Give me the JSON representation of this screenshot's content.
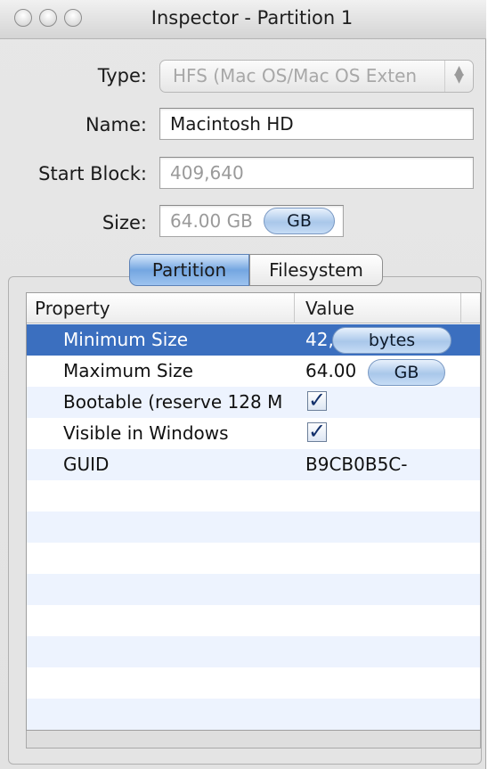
{
  "window": {
    "title": "Inspector - Partition 1"
  },
  "form": {
    "type_label": "Type:",
    "type_value": "HFS (Mac OS/Mac OS Exten",
    "name_label": "Name:",
    "name_value": "Macintosh HD",
    "start_block_label": "Start Block:",
    "start_block_value": "409,640",
    "size_label": "Size:",
    "size_value": "64.00 GB",
    "size_unit": "GB"
  },
  "tabs": {
    "partition": "Partition",
    "filesystem": "Filesystem"
  },
  "table": {
    "columns": [
      "Property",
      "Value"
    ],
    "rows": [
      {
        "property": "Minimum Size",
        "value": "42,72",
        "unit": "bytes",
        "selected": true
      },
      {
        "property": "Maximum Size",
        "value": "64.00",
        "unit": "GB"
      },
      {
        "property": "Bootable (reserve 128 M",
        "checked": true
      },
      {
        "property": "Visible in Windows",
        "checked": true
      },
      {
        "property": "GUID",
        "value": "B9CB0B5C-"
      }
    ]
  },
  "colors": {
    "selection": "#3b6fbf",
    "stripe": "#edf3fe",
    "aqua_blue": "#74a6e1"
  },
  "icons": {
    "close": "window-close-icon",
    "minimize": "window-minimize-icon",
    "zoom": "window-zoom-icon",
    "popup_arrows": "updown-arrows-icon",
    "checkbox": "checkmark-icon"
  }
}
